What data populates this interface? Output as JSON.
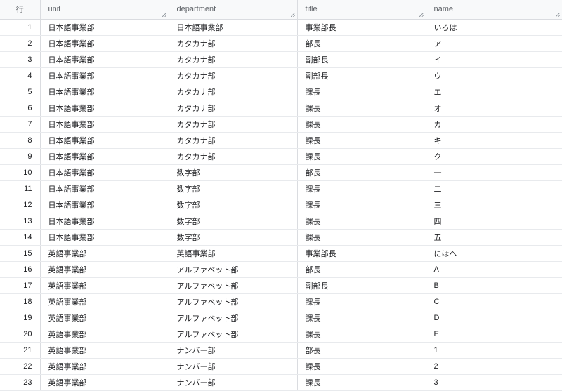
{
  "table": {
    "headers": {
      "row": "行",
      "unit": "unit",
      "department": "department",
      "title": "title",
      "name": "name"
    },
    "rows": [
      {
        "row": "1",
        "unit": "日本語事業部",
        "department": "日本語事業部",
        "title": "事業部長",
        "name": "いろは"
      },
      {
        "row": "2",
        "unit": "日本語事業部",
        "department": "カタカナ部",
        "title": "部長",
        "name": "ア"
      },
      {
        "row": "3",
        "unit": "日本語事業部",
        "department": "カタカナ部",
        "title": "副部長",
        "name": "イ"
      },
      {
        "row": "4",
        "unit": "日本語事業部",
        "department": "カタカナ部",
        "title": "副部長",
        "name": "ウ"
      },
      {
        "row": "5",
        "unit": "日本語事業部",
        "department": "カタカナ部",
        "title": "課長",
        "name": "エ"
      },
      {
        "row": "6",
        "unit": "日本語事業部",
        "department": "カタカナ部",
        "title": "課長",
        "name": "オ"
      },
      {
        "row": "7",
        "unit": "日本語事業部",
        "department": "カタカナ部",
        "title": "課長",
        "name": "カ"
      },
      {
        "row": "8",
        "unit": "日本語事業部",
        "department": "カタカナ部",
        "title": "課長",
        "name": "キ"
      },
      {
        "row": "9",
        "unit": "日本語事業部",
        "department": "カタカナ部",
        "title": "課長",
        "name": "ク"
      },
      {
        "row": "10",
        "unit": "日本語事業部",
        "department": "数字部",
        "title": "部長",
        "name": "一"
      },
      {
        "row": "11",
        "unit": "日本語事業部",
        "department": "数字部",
        "title": "課長",
        "name": "二"
      },
      {
        "row": "12",
        "unit": "日本語事業部",
        "department": "数字部",
        "title": "課長",
        "name": "三"
      },
      {
        "row": "13",
        "unit": "日本語事業部",
        "department": "数字部",
        "title": "課長",
        "name": "四"
      },
      {
        "row": "14",
        "unit": "日本語事業部",
        "department": "数字部",
        "title": "課長",
        "name": "五"
      },
      {
        "row": "15",
        "unit": "英語事業部",
        "department": "英語事業部",
        "title": "事業部長",
        "name": "にほへ"
      },
      {
        "row": "16",
        "unit": "英語事業部",
        "department": "アルファベット部",
        "title": "部長",
        "name": "A"
      },
      {
        "row": "17",
        "unit": "英語事業部",
        "department": "アルファベット部",
        "title": "副部長",
        "name": "B"
      },
      {
        "row": "18",
        "unit": "英語事業部",
        "department": "アルファベット部",
        "title": "課長",
        "name": "C"
      },
      {
        "row": "19",
        "unit": "英語事業部",
        "department": "アルファベット部",
        "title": "課長",
        "name": "D"
      },
      {
        "row": "20",
        "unit": "英語事業部",
        "department": "アルファベット部",
        "title": "課長",
        "name": "E"
      },
      {
        "row": "21",
        "unit": "英語事業部",
        "department": "ナンバー部",
        "title": "部長",
        "name": "1"
      },
      {
        "row": "22",
        "unit": "英語事業部",
        "department": "ナンバー部",
        "title": "課長",
        "name": "2"
      },
      {
        "row": "23",
        "unit": "英語事業部",
        "department": "ナンバー部",
        "title": "課長",
        "name": "3"
      }
    ]
  },
  "colors": {
    "accent": "#1a73e8",
    "header_bg": "#f8f9fa",
    "border": "#dadce0"
  }
}
